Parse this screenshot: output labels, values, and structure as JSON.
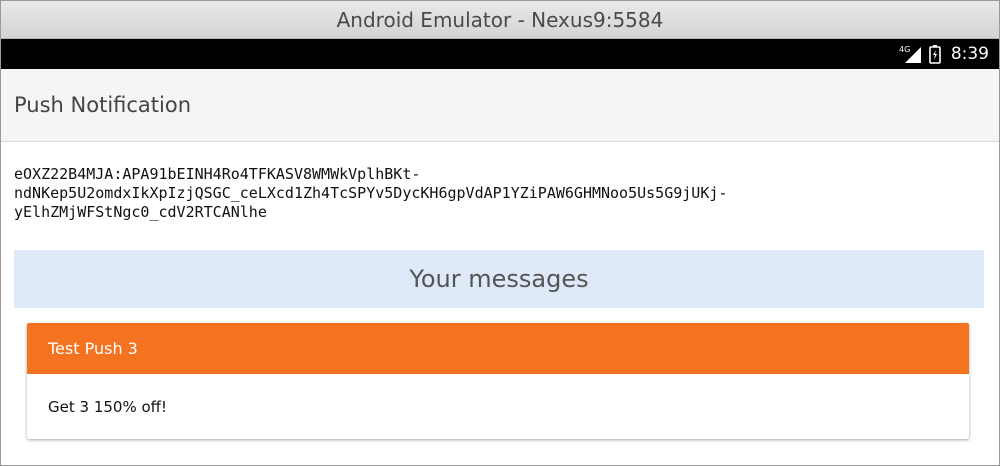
{
  "window": {
    "title": "Android Emulator - Nexus9:5584"
  },
  "status_bar": {
    "network": "4G",
    "time": "8:39",
    "icons": [
      "signal-icon",
      "battery-icon"
    ]
  },
  "toolbar": {
    "title": "Push Notification"
  },
  "token": {
    "lines": [
      "eOXZ22B4MJA:APA91bEINH4Ro4TFKASV8WMWkVplhBKt-",
      "ndNKep5U2omdxIkXpIzjQSGC_ceLXcd1Zh4TcSPYv5DycKH6gpVdAP1YZiPAW6GHMNoo5Us5G9jUKj-",
      "yElhZMjWFStNgc0_cdV2RTCANlhe"
    ]
  },
  "messages": {
    "heading": "Your messages",
    "items": [
      {
        "title": "Test Push 3",
        "body": "Get 3 150% off!"
      }
    ]
  },
  "colors": {
    "card_header": "#f47320",
    "messages_header_bg": "#deeaf7",
    "status_bar": "#000000",
    "toolbar_bg": "#f5f5f5"
  }
}
